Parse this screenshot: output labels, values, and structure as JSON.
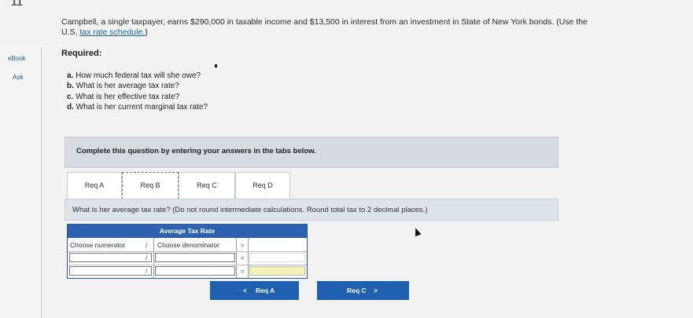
{
  "page_number": "11",
  "side_nav": {
    "items": [
      {
        "label": "eBook"
      },
      {
        "label": "Ask"
      }
    ]
  },
  "question": {
    "intro": "Campbell, a single taxpayer, earns $290,000 in taxable income and $13,500 in interest from an investment in State of New York bonds. (Use the U.S. ",
    "link_text": "tax rate schedule.",
    "outro": ")"
  },
  "required_label": "Required:",
  "parts": [
    {
      "letter": "a.",
      "text": "How much federal tax will she owe?"
    },
    {
      "letter": "b.",
      "text": "What is her average tax rate?"
    },
    {
      "letter": "c.",
      "text": "What is her effective tax rate?"
    },
    {
      "letter": "d.",
      "text": "What is her current marginal tax rate?"
    }
  ],
  "instructions": "Complete this question by entering your answers in the tabs below.",
  "tabs": [
    {
      "label": "Req A"
    },
    {
      "label": "Req B"
    },
    {
      "label": "Req C"
    },
    {
      "label": "Req D"
    }
  ],
  "tab_prompt": "What is her average tax rate? (Do not round intermediate calculations. Round total tax to 2 decimal places.)",
  "table": {
    "title": "Average Tax Rate",
    "numerator_placeholder": "Choose numerator",
    "denominator_placeholder": "Choose denominator",
    "divide_symbol": "/",
    "equals_symbol": "=",
    "rows": [
      {
        "numerator": "",
        "denominator": "",
        "result": ""
      },
      {
        "numerator": "",
        "denominator": "",
        "result": ""
      }
    ]
  },
  "buttons": {
    "prev_label": "Req A",
    "prev_chevron": "<",
    "next_label": "Req C",
    "next_chevron": ">"
  }
}
